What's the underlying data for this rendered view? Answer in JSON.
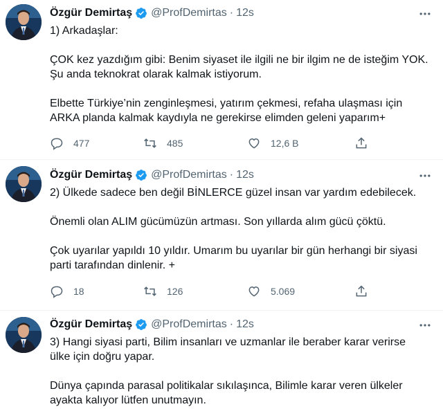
{
  "tweets": [
    {
      "author": {
        "name": "Özgür Demirtaş",
        "handle": "@ProfDemirtas"
      },
      "time": "12s",
      "lines": [
        "1) Arkadaşlar:",
        "",
        "ÇOK kez yazdığım gibi: Benim siyaset ile ilgili ne bir ilgim ne de isteğim YOK.",
        "Şu anda teknokrat olarak kalmak istiyorum.",
        "",
        "Elbette Türkiye’nin zenginleşmesi, yatırım çekmesi, refaha ulaşması için",
        "ARKA planda kalmak kaydıyla ne gerekirse elimden geleni yaparım+"
      ],
      "replies": "477",
      "retweets": "485",
      "likes": "12,6 B"
    },
    {
      "author": {
        "name": "Özgür Demirtaş",
        "handle": "@ProfDemirtas"
      },
      "time": "12s",
      "lines": [
        "2) Ülkede sadece ben değil BİNLERCE güzel insan var yardım edebilecek.",
        "",
        "Önemli olan ALIM gücümüzün artması. Son yıllarda alım gücü çöktü.",
        "",
        "Çok uyarılar yapıldı 10 yıldır. Umarım bu uyarılar bir gün herhangi bir siyasi",
        "parti tarafından dinlenir. +"
      ],
      "replies": "18",
      "retweets": "126",
      "likes": "5.069"
    },
    {
      "author": {
        "name": "Özgür Demirtaş",
        "handle": "@ProfDemirtas"
      },
      "time": "12s",
      "lines": [
        "3) Hangi siyasi parti, Bilim insanları ve uzmanlar ile beraber karar verirse",
        "ülke için doğru yapar.",
        "",
        "Dünya çapında parasal politikalar sıkılaşınca, Bilimle karar veren ülkeler",
        "ayakta kalıyor lütfen unutmayın."
      ]
    }
  ],
  "icons": {
    "verified": "verified-badge-icon",
    "more": "more-dots-icon",
    "reply": "reply-icon",
    "retweet": "retweet-icon",
    "like": "heart-icon",
    "share": "share-icon"
  },
  "colors": {
    "verified": "#1d9bf0",
    "muted": "#536471",
    "text": "#0f1419"
  }
}
